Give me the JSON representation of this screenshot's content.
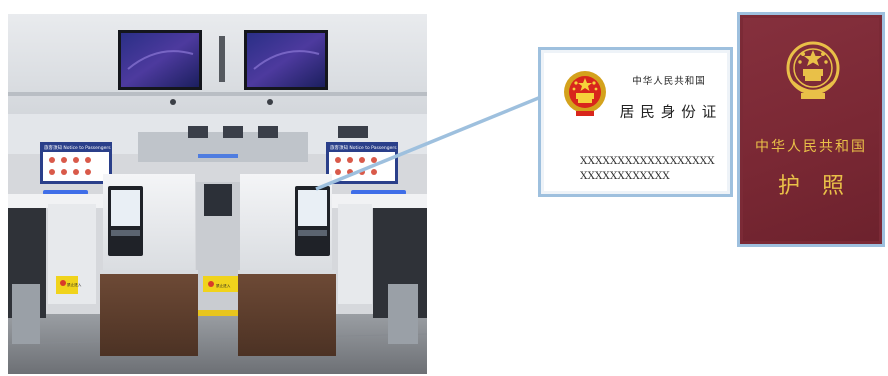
{
  "photo": {
    "caption": "",
    "sign_text": "旅客须知 Notice to Passengers",
    "warning_label": "禁止进入"
  },
  "id_card": {
    "country": "中华人民共和国",
    "title": "居民身份证",
    "number_line1": "XXXXXXXXXXXXXXXXXX",
    "number_line2": "XXXXXXXXXXXX",
    "border_color": "#9ec0de"
  },
  "passport": {
    "country": "中华人民共和国",
    "title": "护照",
    "cover_color": "#7b2a36",
    "text_color": "#e9c048"
  }
}
